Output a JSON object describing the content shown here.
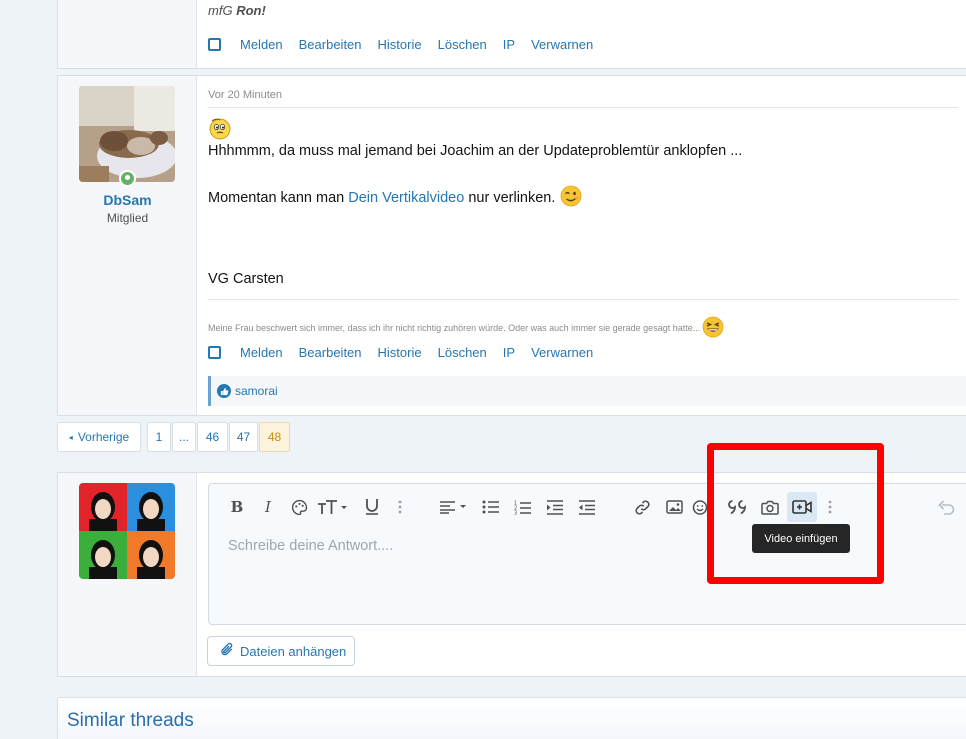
{
  "prev_post": {
    "signature_text": "mfG",
    "signature_name": "Ron!",
    "actions": [
      "Melden",
      "Bearbeiten",
      "Historie",
      "Löschen",
      "IP",
      "Verwarnen"
    ]
  },
  "post": {
    "username": "DbSam",
    "user_title": "Mitglied",
    "date": "Vor 20 Minuten",
    "line1": "Hhhmmm, da muss mal jemand bei Joachim an der Updateproblemtür anklopfen ...",
    "line2_before": "Momentan kann man",
    "line2_link": "Dein Vertikalvideo",
    "line2_after": "nur verlinken.",
    "closing": "VG Carsten",
    "signature": "Meine Frau beschwert sich immer, dass ich ihr nicht richtig zuhören würde. Oder was auch immer sie gerade gesagt hatte...",
    "actions": [
      "Melden",
      "Bearbeiten",
      "Historie",
      "Löschen",
      "IP",
      "Verwarnen"
    ],
    "reaction_user": "samorai"
  },
  "pagination": {
    "prev_label": "Vorherige",
    "pages": [
      "1",
      "...",
      "46",
      "47",
      "48"
    ],
    "current": "48"
  },
  "editor": {
    "placeholder": "Schreibe deine Antwort....",
    "tooltip": "Video einfügen",
    "attach_label": "Dateien anhängen",
    "toolbar_icons": [
      "bold-icon",
      "italic-icon",
      "palette-icon",
      "font-size-icon",
      "underline-icon",
      "more-vertical-icon",
      "align-icon",
      "bullet-list-icon",
      "numbered-list-icon",
      "indent-icon",
      "outdent-icon",
      "link-icon",
      "image-icon",
      "smiley-icon",
      "quote-icon",
      "camera-icon",
      "video-icon",
      "more-vertical-icon",
      "undo-icon"
    ]
  },
  "similar_threads": {
    "title": "Similar threads"
  },
  "colors": {
    "accent": "#2577b1",
    "highlight": "#ff0000",
    "tooltip_bg": "#262626"
  }
}
